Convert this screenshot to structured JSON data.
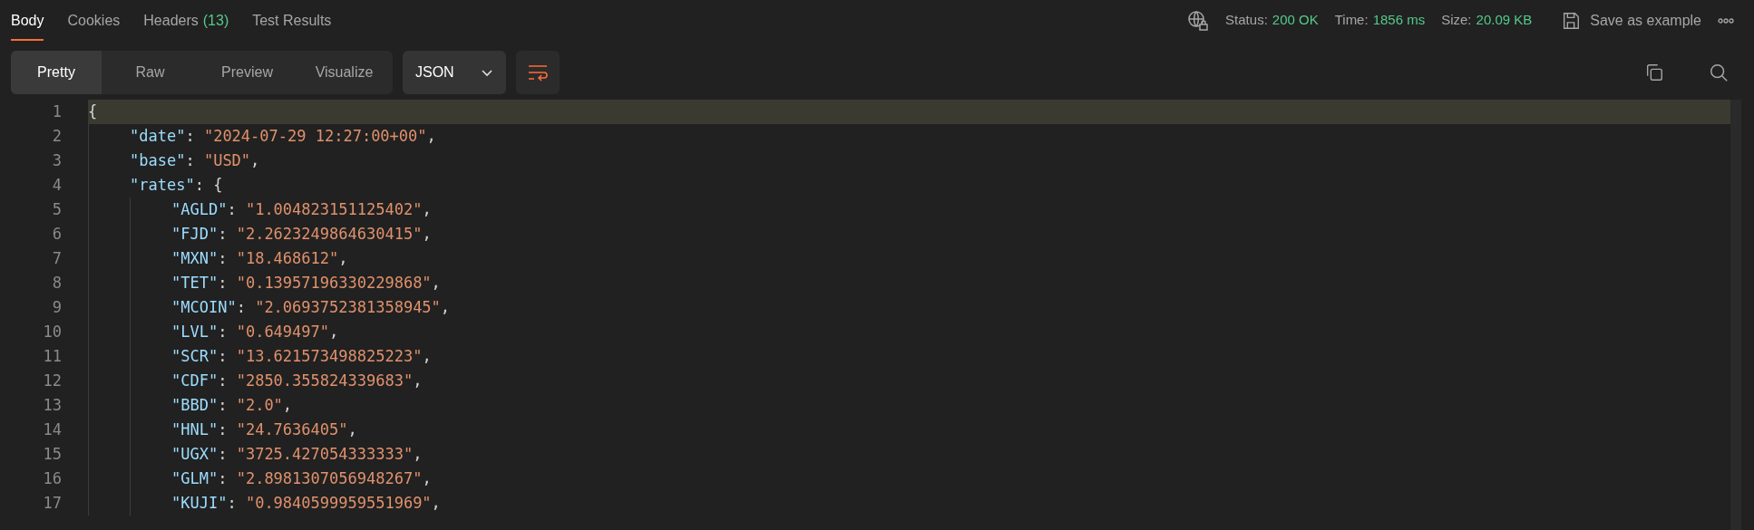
{
  "tabs": [
    {
      "label": "Body",
      "selected": true
    },
    {
      "label": "Cookies",
      "selected": false
    },
    {
      "label": "Headers",
      "count": "(13)",
      "selected": false
    },
    {
      "label": "Test Results",
      "selected": false
    }
  ],
  "status_items": [
    {
      "label": "Status:",
      "value": "200 OK"
    },
    {
      "label": "Time:",
      "value": "1856 ms"
    },
    {
      "label": "Size:",
      "value": "20.09 KB"
    }
  ],
  "save_button": "Save as example",
  "view_modes": [
    {
      "label": "Pretty",
      "selected": true
    },
    {
      "label": "Raw",
      "selected": false
    },
    {
      "label": "Preview",
      "selected": false
    },
    {
      "label": "Visualize",
      "selected": false
    }
  ],
  "format_dropdown": "JSON",
  "code_lines": [
    {
      "number": "1",
      "brace": "{",
      "selected": true
    },
    {
      "number": "2",
      "key": "\"date\"",
      "sep": ": ",
      "value": "\"2024-07-29 12:27:00+00\"",
      "trail": ",",
      "selected": false
    },
    {
      "number": "3",
      "key": "\"base\"",
      "sep": ": ",
      "value": "\"USD\"",
      "trail": ",",
      "selected": false
    },
    {
      "number": "4",
      "key": "\"rates\"",
      "sep": ": ",
      "brace": "{",
      "selected": false,
      "children": [
        {
          "number": "5",
          "key": "\"AGLD\"",
          "sep": ": ",
          "value": "\"1.004823151125402\"",
          "trail": ",",
          "selected": false
        },
        {
          "number": "6",
          "key": "\"FJD\"",
          "sep": ": ",
          "value": "\"2.2623249864630415\"",
          "trail": ",",
          "selected": false
        },
        {
          "number": "7",
          "key": "\"MXN\"",
          "sep": ": ",
          "value": "\"18.468612\"",
          "trail": ",",
          "selected": false
        },
        {
          "number": "8",
          "key": "\"TET\"",
          "sep": ": ",
          "value": "\"0.13957196330229868\"",
          "trail": ",",
          "selected": false
        },
        {
          "number": "9",
          "key": "\"MCOIN\"",
          "sep": ": ",
          "value": "\"2.0693752381358945\"",
          "trail": ",",
          "selected": false
        },
        {
          "number": "10",
          "key": "\"LVL\"",
          "sep": ": ",
          "value": "\"0.649497\"",
          "trail": ",",
          "selected": false
        },
        {
          "number": "11",
          "key": "\"SCR\"",
          "sep": ": ",
          "value": "\"13.621573498825223\"",
          "trail": ",",
          "selected": false
        },
        {
          "number": "12",
          "key": "\"CDF\"",
          "sep": ": ",
          "value": "\"2850.355824339683\"",
          "trail": ",",
          "selected": false
        },
        {
          "number": "13",
          "key": "\"BBD\"",
          "sep": ": ",
          "value": "\"2.0\"",
          "trail": ",",
          "selected": false
        },
        {
          "number": "14",
          "key": "\"HNL\"",
          "sep": ": ",
          "value": "\"24.7636405\"",
          "trail": ",",
          "selected": false
        },
        {
          "number": "15",
          "key": "\"UGX\"",
          "sep": ": ",
          "value": "\"3725.427054333333\"",
          "trail": ",",
          "selected": false
        },
        {
          "number": "16",
          "key": "\"GLM\"",
          "sep": ": ",
          "value": "\"2.8981307056948267\"",
          "trail": ",",
          "selected": false
        },
        {
          "number": "17",
          "key": "\"KUJI\"",
          "sep": ": ",
          "value": "\"0.9840599959551969\"",
          "trail": ",",
          "selected": false
        }
      ]
    }
  ]
}
